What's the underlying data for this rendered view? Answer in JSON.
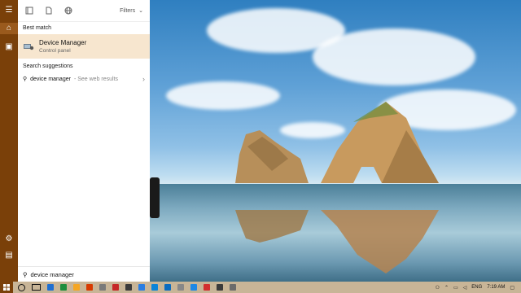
{
  "search_panel": {
    "filters_label": "Filters",
    "best_match_heading": "Best match",
    "best_match": {
      "title": "Device Manager",
      "subtitle": "Control panel"
    },
    "suggestions_heading": "Search suggestions",
    "suggestions": [
      {
        "text": "device manager",
        "sub": "- See web results"
      }
    ],
    "search_query": "device manager"
  },
  "taskbar": {
    "language": "ENG",
    "time": "7:19 AM",
    "icon_colors": [
      "#1f6fd1",
      "#1e8e3e",
      "#f5a623",
      "#d83b01",
      "#7a7a7a",
      "#c62828",
      "#3b3b3b",
      "#2a7de1",
      "#0a84d8",
      "#0b6cbf",
      "#888888",
      "#1e88e5",
      "#d32f2f",
      "#3b3b3b",
      "#6b6b6b"
    ]
  },
  "colors": {
    "accent": "#7a4009",
    "best_match_bg": "#f7e6cf",
    "taskbar_bg": "#c8b597"
  }
}
